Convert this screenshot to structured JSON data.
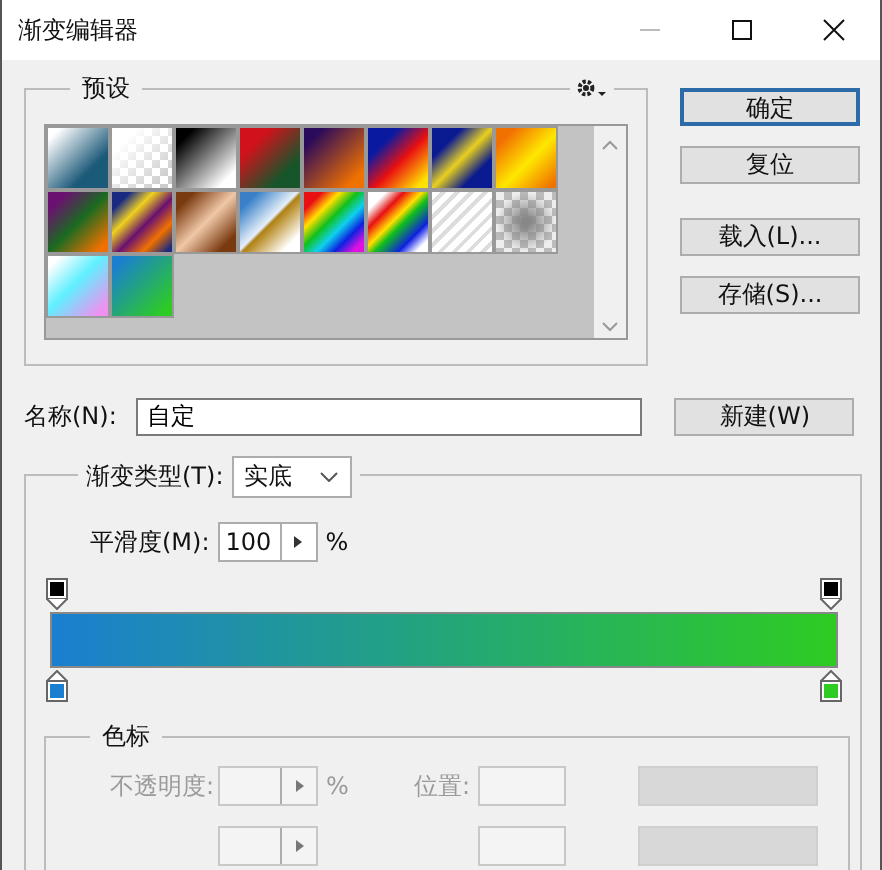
{
  "window": {
    "title": "渐变编辑器"
  },
  "presets": {
    "legend": "预设"
  },
  "buttons": [
    {
      "label": "确定",
      "default": true
    },
    {
      "label": "复位",
      "default": false
    },
    {
      "label": "载入(L)...",
      "default": false
    },
    {
      "label": "存储(S)...",
      "default": false
    }
  ],
  "name": {
    "label": "名称(N):",
    "value": "自定",
    "button": "新建(W)"
  },
  "gradient": {
    "type_label": "渐变类型(T):",
    "type_value": "实底",
    "smooth_label": "平滑度(M):",
    "smooth_value": "100",
    "smooth_unit": "%",
    "opacity_stops": [
      {
        "color": "#000000"
      },
      {
        "color": "#000000"
      }
    ],
    "color_stops": [
      {
        "color": "#1a7fd0"
      },
      {
        "color": "#2ecc22"
      }
    ]
  },
  "stops": {
    "legend": "色标",
    "opacity_label": "不透明度:",
    "opacity_unit": "%",
    "location_label": "位置:",
    "disabled": true
  }
}
